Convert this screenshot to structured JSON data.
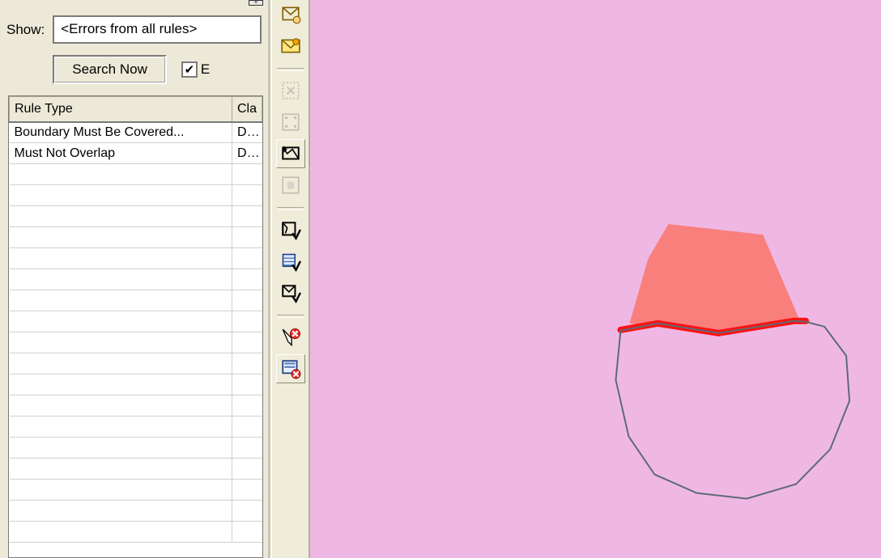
{
  "panel": {
    "show_label": "Show:",
    "filter_value": "<Errors from all rules>",
    "search_button_label": "Search Now",
    "checkbox_checked": true,
    "checkbox_label_fragment": "E"
  },
  "table": {
    "headers": [
      "Rule Type",
      "Cla"
    ],
    "rows": [
      {
        "rule": "Boundary Must Be Covered...",
        "cls": "DLT"
      },
      {
        "rule": "Must Not Overlap",
        "cls": "DLT"
      }
    ],
    "empty_rows": 18
  },
  "toolbar_icons": [
    "error-inspector-icon",
    "envelope-icon",
    "validate-selection-icon",
    "validate-extent-icon",
    "fix-topology-icon",
    "topology-tools-icon",
    "validate-layer-check-icon",
    "attribute-check-icon",
    "feature-check-icon",
    "delete-error-icon",
    "mark-exception-icon"
  ],
  "map": {
    "background_color": "#efb8e4",
    "features": [
      {
        "type": "overlap-polygon",
        "fill": "#f97b77"
      },
      {
        "type": "boundary-error-line",
        "stroke": "#ff0000"
      },
      {
        "type": "polygon-outline",
        "stroke": "#5e6a77"
      }
    ]
  }
}
